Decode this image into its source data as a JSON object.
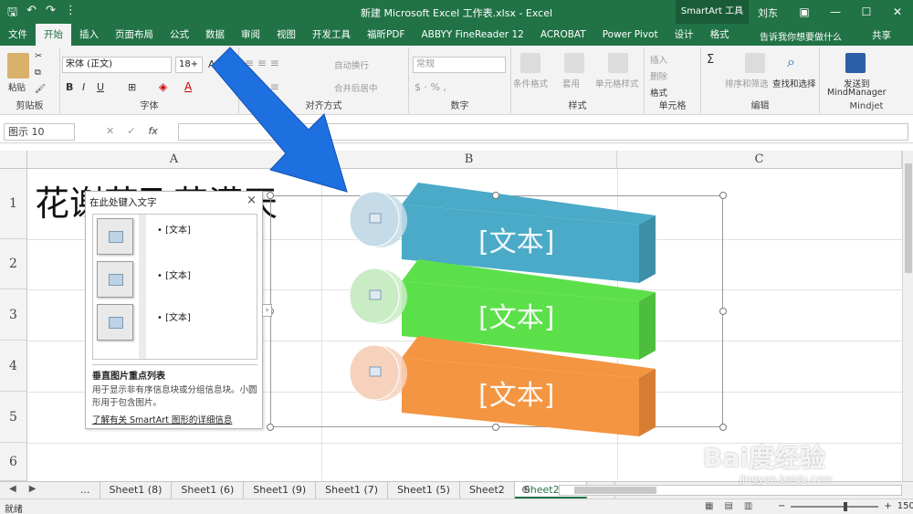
{
  "titlebar": {
    "doc_title": "新建 Microsoft Excel 工作表.xlsx  -  Excel",
    "context_tab": "SmartArt 工具",
    "user": "刘东",
    "qat": [
      "save-icon",
      "undo-icon",
      "redo-icon"
    ]
  },
  "ribbon_tabs": [
    "文件",
    "开始",
    "插入",
    "页面布局",
    "公式",
    "数据",
    "审阅",
    "视图",
    "开发工具",
    "福昕PDF",
    "ABBYY FineReader 12",
    "ACROBAT",
    "Power Pivot",
    "设计",
    "格式"
  ],
  "tellme": "告诉我你想要做什么",
  "share": "共享",
  "ribbon": {
    "paste": "粘贴",
    "clipboard": "剪贴板",
    "font_name": "宋体 (正文)",
    "font_size": "18+",
    "font_group": "字体",
    "wrap_text": "自动换行",
    "merge_center": "合并后居中",
    "align_group": "对齐方式",
    "number_format": "常规",
    "number_group": "数字",
    "cond_format": "条件格式",
    "table_format": "套用\n表格格式",
    "cell_styles": "单元格样式",
    "styles_group": "样式",
    "insert": "插入",
    "delete": "删除",
    "format": "格式",
    "cells_group": "单元格",
    "sort_filter": "排序和筛选",
    "find_select": "查找和选择",
    "edit_group": "编辑",
    "send_to": "发送到",
    "mindmanager": "MindManager",
    "mindjet": "Mindjet"
  },
  "formula_bar": {
    "name_box": "图示 10",
    "cancel": "✕",
    "enter": "✓",
    "fx": "fx",
    "value": ""
  },
  "columns": [
    "A",
    "B",
    "C"
  ],
  "rows": [
    "1",
    "2",
    "3",
    "4",
    "5",
    "6"
  ],
  "cell_a1": "花谢花飞花满天",
  "smartart": {
    "items": [
      {
        "text": "[文本]",
        "color": "#4aaac8",
        "dark": "#3d8fa9",
        "circle": "#c5dce8"
      },
      {
        "text": "[文本]",
        "color": "#5ce04a",
        "dark": "#4cbd3c",
        "circle": "#c9ecc4"
      },
      {
        "text": "[文本]",
        "color": "#f49542",
        "dark": "#d57d33",
        "circle": "#f6d2bc"
      }
    ]
  },
  "text_pane": {
    "title": "在此处键入文字",
    "close": "×",
    "bullets": [
      "[文本]",
      "[文本]",
      "[文本]"
    ],
    "layout_name": "垂直图片重点列表",
    "description": "用于显示非有序信息块或分组信息块。小圆形用于包含图片。",
    "link": "了解有关 SmartArt 图形的详细信息"
  },
  "sheets": [
    "...",
    "Sheet1 (8)",
    "Sheet1 (6)",
    "Sheet1 (9)",
    "Sheet1 (7)",
    "Sheet1 (5)",
    "Sheet2",
    "Sheet2 (2)",
    "..."
  ],
  "active_sheet_index": 7,
  "status": {
    "ready": "就绪",
    "zoom": "150%"
  },
  "watermark": {
    "brand": "Bai度经验",
    "url": "jingyan.baidu.com"
  },
  "arrow_color": "#1e6fe0"
}
